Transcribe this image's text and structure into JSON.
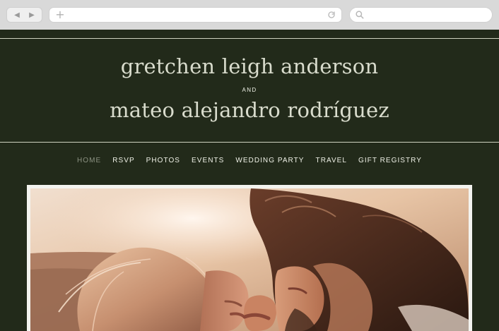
{
  "browser": {
    "back_label": "◀",
    "forward_label": "▶",
    "url_placeholder": "",
    "search_placeholder": "",
    "icons": {
      "back": "chevron-left-icon",
      "forward": "chevron-right-icon",
      "add": "plus-icon",
      "reload": "reload-icon",
      "search": "search-icon"
    }
  },
  "site": {
    "name_1": "gretchen leigh anderson",
    "joiner": "AND",
    "name_2": "mateo alejandro rodríguez",
    "nav": [
      "HOME",
      "RSVP",
      "PHOTOS",
      "EVENTS",
      "WEDDING PARTY",
      "TRAVEL",
      "GIFT REGISTRY"
    ],
    "active_nav_index": 0,
    "colors": {
      "background": "#222a1a",
      "text": "#d9dccd",
      "nav_active": "#8c9282",
      "frame": "#f3f3ef"
    }
  }
}
